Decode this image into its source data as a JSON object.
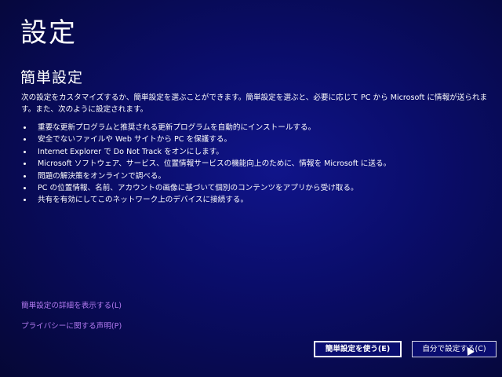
{
  "page": {
    "title": "設定"
  },
  "section": {
    "title": "簡単設定",
    "description": "次の設定をカスタマイズするか、簡単設定を選ぶことができます。簡単設定を選ぶと、必要に応じて PC から Microsoft に情報が送られます。また、次のように設定されます。"
  },
  "settings_list": [
    "重要な更新プログラムと推奨される更新プログラムを自動的にインストールする。",
    "安全でないファイルや Web サイトから PC を保護する。",
    "Internet Explorer で Do Not Track をオンにします。",
    "Microsoft ソフトウェア、サービス、位置情報サービスの機能向上のために、情報を Microsoft に送る。",
    "問題の解決策をオンラインで調べる。",
    "PC の位置情報、名前、アカウントの画像に基づいて個別のコンテンツをアプリから受け取る。",
    "共有を有効にしてこのネットワーク上のデバイスに接続する。"
  ],
  "links": {
    "details": "簡単設定の詳細を表示する(L)",
    "privacy": "プライバシーに関する声明(P)"
  },
  "buttons": {
    "express": "簡単設定を使う(E)",
    "custom": "自分で設定する(C)"
  },
  "colors": {
    "background": "#0a0d6a",
    "link": "#b27af0",
    "text": "#ffffff"
  }
}
